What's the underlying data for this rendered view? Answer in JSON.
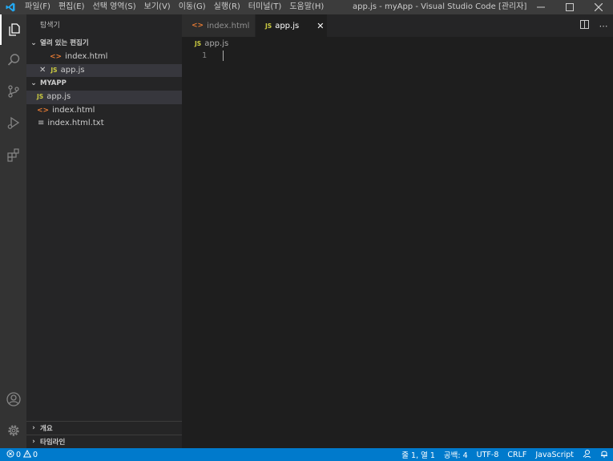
{
  "app": {
    "window_title": "app.js - myApp - Visual Studio Code [관리자]",
    "menu": [
      "파일(F)",
      "편집(E)",
      "선택 영역(S)",
      "보기(V)",
      "이동(G)",
      "실행(R)",
      "터미널(T)",
      "도움말(H)"
    ]
  },
  "activity_bar": {
    "icons": [
      "explorer-icon",
      "search-icon",
      "source-control-icon",
      "run-debug-icon",
      "extensions-icon",
      "account-icon",
      "settings-gear-icon"
    ]
  },
  "sidebar": {
    "title": "탐색기",
    "open_editors": {
      "label": "열려 있는 편집기",
      "items": [
        {
          "icon": "<>",
          "name": "index.html"
        },
        {
          "close": "✕",
          "icon": "JS",
          "name": "app.js"
        }
      ]
    },
    "folder": {
      "label": "MYAPP",
      "items": [
        {
          "icon": "JS",
          "name": "app.js"
        },
        {
          "icon": "<>",
          "name": "index.html"
        },
        {
          "icon": "≡",
          "name": "index.html.txt"
        }
      ]
    },
    "outline_label": "개요",
    "timeline_label": "타임라인"
  },
  "editor": {
    "tabs": [
      {
        "icon": "<>",
        "name": "index.html"
      },
      {
        "icon": "JS",
        "name": "app.js",
        "close": "✕"
      }
    ],
    "breadcrumb_icon": "JS",
    "breadcrumb": "app.js",
    "line_numbers": [
      "1"
    ]
  },
  "status_bar": {
    "errors": "0",
    "warnings": "0",
    "position": "줄 1, 열 1",
    "indent": "공백: 4",
    "encoding": "UTF-8",
    "eol": "CRLF",
    "language": "JavaScript"
  },
  "colors": {
    "accent": "#007acc",
    "js_icon": "#cbcb41",
    "html_icon": "#e37933"
  }
}
